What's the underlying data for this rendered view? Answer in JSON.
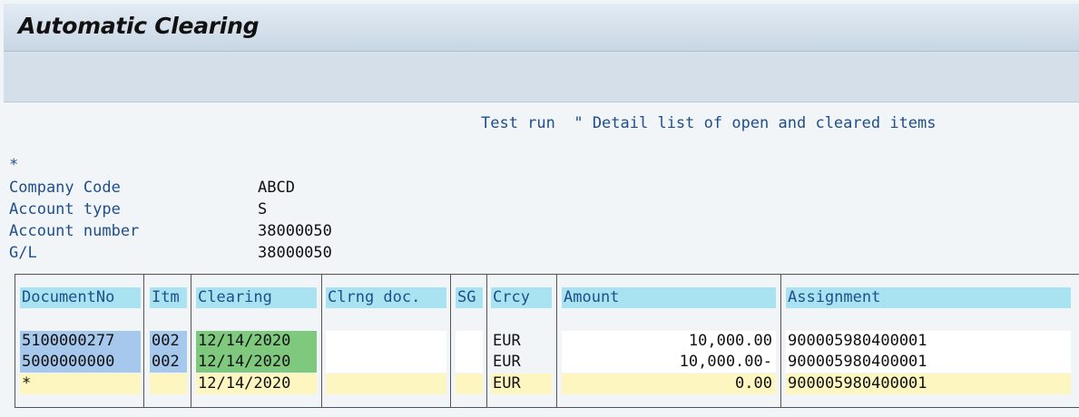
{
  "window": {
    "title": "Automatic Clearing"
  },
  "info_line": "Test run  \" Detail list of open and cleared items",
  "asterisk": "*",
  "params": [
    {
      "label": "Company Code",
      "value": "ABCD"
    },
    {
      "label": "Account type",
      "value": "S"
    },
    {
      "label": "Account number",
      "value": "38000050"
    },
    {
      "label": "G/L",
      "value": "38000050"
    }
  ],
  "table": {
    "headers": [
      "DocumentNo",
      "Itm",
      "Clearing",
      "Clrng doc.",
      "SG",
      "Crcy",
      "Amount",
      "Assignment"
    ],
    "rows": [
      [
        "5100000277",
        "002",
        "12/14/2020",
        "",
        "",
        "EUR",
        "10,000.00",
        "900005980400001"
      ],
      [
        "5000000000",
        "002",
        "12/14/2020",
        "",
        "",
        "EUR",
        "10,000.00-",
        "900005980400001"
      ]
    ],
    "total": [
      "*",
      "",
      "12/14/2020",
      "",
      "",
      "EUR",
      "0.00",
      "900005980400001"
    ]
  },
  "colors": {
    "header_bg": "#a9e3f2",
    "key_bg": "#a6c8ec",
    "clearing_bg": "#7fc97f",
    "total_bg": "#fdf6c0",
    "text_blue": "#1f4e8c"
  }
}
